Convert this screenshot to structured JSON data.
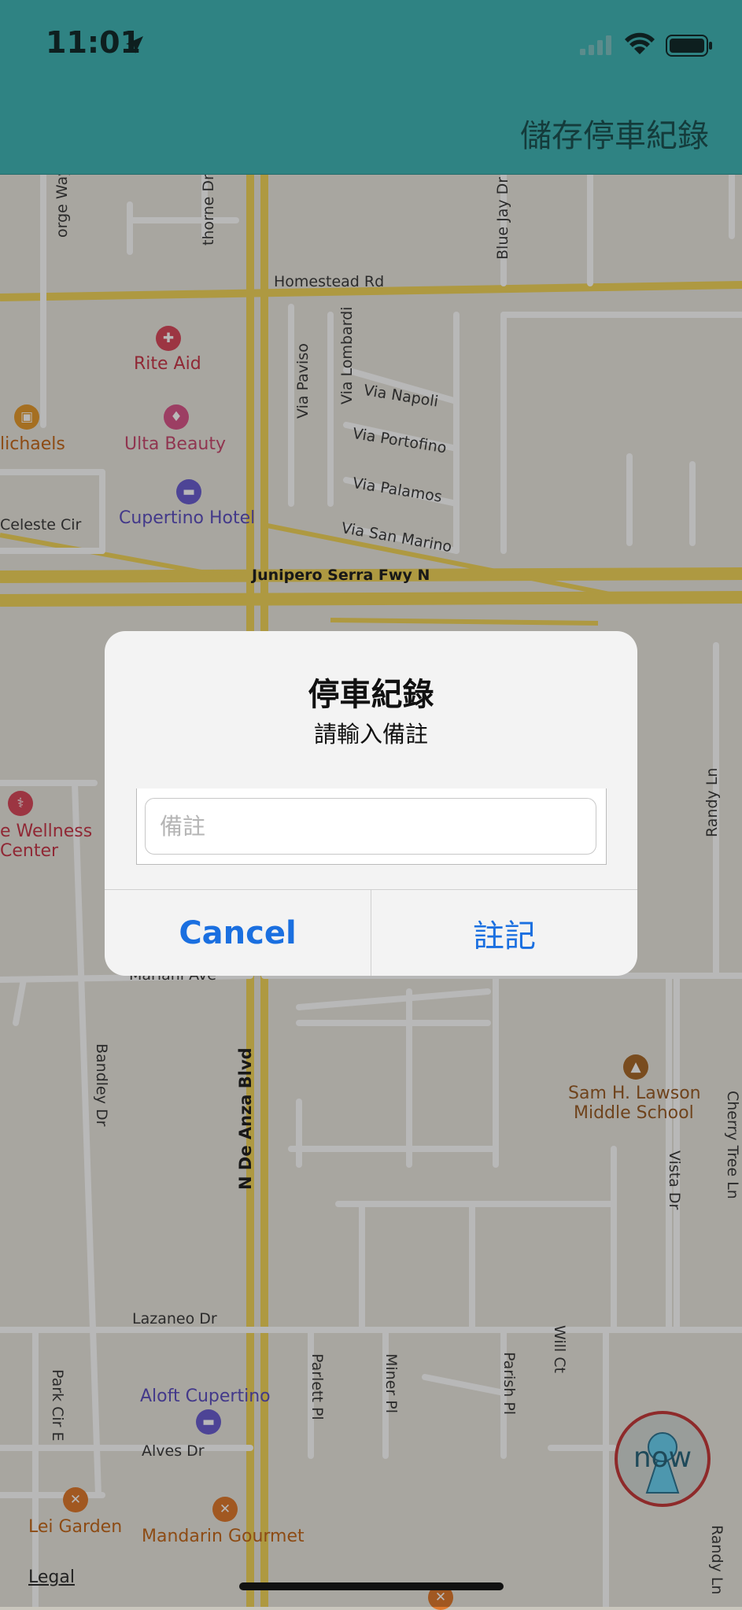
{
  "status_bar": {
    "time": "11:01"
  },
  "nav": {
    "title": "儲存停車紀錄"
  },
  "map": {
    "streets": {
      "homestead": "Homestead Rd",
      "junipero": "Junipero Serra Fwy N",
      "via_napoli": "Via Napoli",
      "via_portofino": "Via Portofino",
      "via_palamos": "Via Palamos",
      "via_san_marino": "Via San Marino",
      "via_paviso": "Via Paviso",
      "via_lombardi": "Via Lombardi",
      "blue_jay": "Blue Jay Dr",
      "celeste": "Celeste Cir",
      "de_anza": "N De Anza Blvd",
      "bandley": "Bandley Dr",
      "mariani": "Mariani Ave",
      "lazaneo": "Lazaneo Dr",
      "alves": "Alves Dr",
      "park_cir": "Park Cir E",
      "parlett": "Parlett Pl",
      "miner": "Miner Pl",
      "parish": "Parish Pl",
      "will": "Will Ct",
      "vista": "Vista Dr",
      "cherry": "Cherry Tree Ln",
      "randy_top": "Randy Ln",
      "randy_bottom": "Randy Ln",
      "orge": "orge Way",
      "thorne": "thorne Dr"
    },
    "pois": {
      "rite_aid": "Rite Aid",
      "michaels": "lichaels",
      "ulta": "Ulta Beauty",
      "cupertino_hotel": "Cupertino Hotel",
      "wellness_1": "e Wellness",
      "wellness_2": "Center",
      "lawson_1": "Sam H. Lawson",
      "lawson_2": "Middle School",
      "aloft": "Aloft Cupertino",
      "lei_garden": "Lei Garden",
      "mandarin": "Mandarin Gourmet"
    },
    "legal": "Legal",
    "now_button": "now"
  },
  "alert": {
    "title": "停車紀錄",
    "message": "請輸入備註",
    "input_placeholder": "備註",
    "input_value": "",
    "cancel_label": "Cancel",
    "confirm_label": "註記"
  },
  "colors": {
    "nav_bar": "#2f8383",
    "alert_button": "#1a6fe0"
  }
}
